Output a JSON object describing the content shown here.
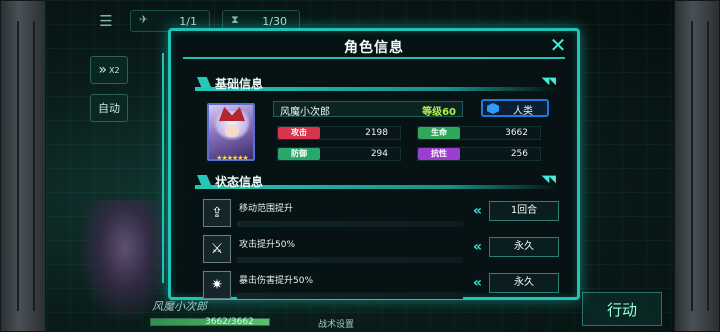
{
  "hud": {
    "turn_counter": "1/1",
    "time_counter": "1/30",
    "speed_label": "X2",
    "auto_label": "自动",
    "action_label": "行动",
    "bottom_char_name": "风魔小次郎",
    "bottom_hp": "3662/3662",
    "bottom_mid_label": "战术设置"
  },
  "dialog": {
    "title": "角色信息",
    "basic_section_title": "基础信息",
    "status_section_title": "状态信息",
    "character": {
      "name": "风魔小次郎",
      "level": "等级60",
      "race": "人类",
      "stars": "★★★★★★",
      "stats": [
        {
          "label": "攻击",
          "value": "2198",
          "color": "#d8344e"
        },
        {
          "label": "生命",
          "value": "3662",
          "color": "#2fa85a"
        },
        {
          "label": "防御",
          "value": "294",
          "color": "#28a86a"
        },
        {
          "label": "抗性",
          "value": "256",
          "color": "#9b3fd0"
        }
      ]
    },
    "statuses": [
      {
        "icon": "move-up-icon",
        "description": "移动范围提升",
        "duration": "1回合"
      },
      {
        "icon": "sword-up-icon",
        "description": "攻击提升50%",
        "duration": "永久"
      },
      {
        "icon": "crit-up-icon",
        "description": "暴击伤害提升50%",
        "duration": "永久"
      }
    ]
  },
  "colors": {
    "panel_border": "#1ec5b7",
    "accent": "#3ff0dc",
    "level_text": "#b7f04a",
    "race_border": "#1f7adf"
  }
}
